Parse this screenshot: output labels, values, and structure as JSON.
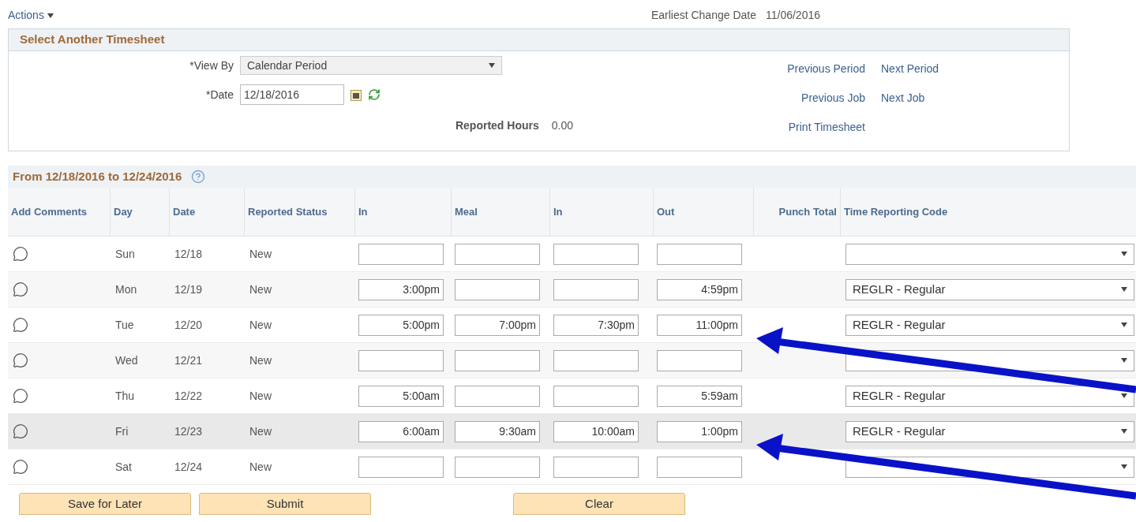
{
  "actions_menu": {
    "label": "Actions"
  },
  "earliest_change": {
    "label": "Earliest Change Date",
    "value": "11/06/2016"
  },
  "select_panel": {
    "title": "Select Another Timesheet",
    "view_by": {
      "label": "*View By",
      "value": "Calendar Period"
    },
    "date": {
      "label": "*Date",
      "value": "12/18/2016"
    },
    "reported_hours": {
      "label": "Reported Hours",
      "value": "0.00"
    },
    "links": [
      {
        "label": "Previous Period"
      },
      {
        "label": "Next Period"
      },
      {
        "label": "Previous Job"
      },
      {
        "label": "Next Job"
      },
      {
        "label": "Print Timesheet"
      }
    ]
  },
  "timesheet": {
    "title": "From 12/18/2016 to 12/24/2016",
    "columns": [
      "Add Comments",
      "Day",
      "Date",
      "Reported Status",
      "In",
      "Meal",
      "In",
      "Out",
      "Punch Total",
      "Time Reporting Code"
    ],
    "rows": [
      {
        "day": "Sun",
        "date": "12/18",
        "status": "New",
        "selected": false,
        "arrow": false
      },
      {
        "day": "Mon",
        "date": "12/19",
        "status": "New",
        "in_1": "3:00pm",
        "out": "4:59pm",
        "code": "REGLR - Regular",
        "selected": false,
        "arrow": false
      },
      {
        "day": "Tue",
        "date": "12/20",
        "status": "New",
        "in_1": "5:00pm",
        "meal": "7:00pm",
        "in_2": "7:30pm",
        "out": "11:00pm",
        "code": "REGLR - Regular",
        "selected": false,
        "arrow": true
      },
      {
        "day": "Wed",
        "date": "12/21",
        "status": "New",
        "selected": false,
        "arrow": false
      },
      {
        "day": "Thu",
        "date": "12/22",
        "status": "New",
        "in_1": "5:00am",
        "out": "5:59am",
        "code": "REGLR - Regular",
        "selected": false,
        "arrow": false
      },
      {
        "day": "Fri",
        "date": "12/23",
        "status": "New",
        "in_1": "6:00am",
        "meal": "9:30am",
        "in_2": "10:00am",
        "out": "1:00pm",
        "code": "REGLR - Regular",
        "selected": true,
        "arrow": true
      },
      {
        "day": "Sat",
        "date": "12/24",
        "status": "New",
        "selected": false,
        "arrow": false
      }
    ]
  },
  "buttons": [
    {
      "label": "Save for Later"
    },
    {
      "label": "Submit"
    },
    {
      "label": "Clear"
    }
  ]
}
